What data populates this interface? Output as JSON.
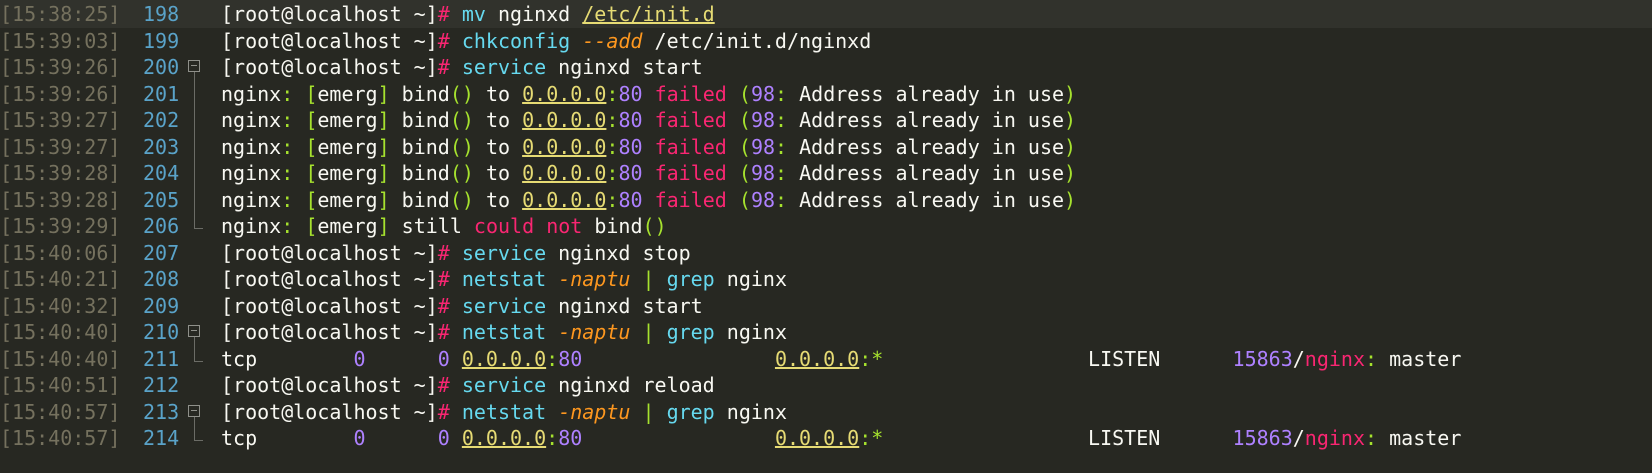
{
  "terminal": {
    "lines": [
      {
        "timestamp": "[15:38:25]",
        "line_number": "198",
        "fold": "none",
        "highlight": true,
        "segments": [
          {
            "t": "[root@localhost ~]",
            "c": "def"
          },
          {
            "t": "# ",
            "c": "pk"
          },
          {
            "t": "mv",
            "c": "cmd"
          },
          {
            "t": " nginxd ",
            "c": "def"
          },
          {
            "t": "/etc/init.d",
            "c": "ip"
          }
        ]
      },
      {
        "timestamp": "[15:39:03]",
        "line_number": "199",
        "fold": "none",
        "segments": [
          {
            "t": "[root@localhost ~]",
            "c": "def"
          },
          {
            "t": "# ",
            "c": "pk"
          },
          {
            "t": "chkconfig",
            "c": "cmd"
          },
          {
            "t": " ",
            "c": "def"
          },
          {
            "t": "--add",
            "c": "opt"
          },
          {
            "t": " /etc/init.d/nginxd",
            "c": "def"
          }
        ]
      },
      {
        "timestamp": "[15:39:26]",
        "line_number": "200",
        "fold": "open",
        "segments": [
          {
            "t": "[root@localhost ~]",
            "c": "def"
          },
          {
            "t": "# ",
            "c": "pk"
          },
          {
            "t": "service",
            "c": "cmd"
          },
          {
            "t": " nginxd start",
            "c": "def"
          }
        ]
      },
      {
        "timestamp": "[15:39:26]",
        "line_number": "201",
        "fold": "line",
        "segments": [
          {
            "t": "nginx",
            "c": "def"
          },
          {
            "t": ": ",
            "c": "br"
          },
          {
            "t": "[",
            "c": "br"
          },
          {
            "t": "emerg",
            "c": "def"
          },
          {
            "t": "]",
            "c": "br"
          },
          {
            "t": " bind",
            "c": "def"
          },
          {
            "t": "()",
            "c": "br"
          },
          {
            "t": " to ",
            "c": "def"
          },
          {
            "t": "0.0.0.0",
            "c": "ip"
          },
          {
            "t": ":",
            "c": "br"
          },
          {
            "t": "80",
            "c": "num"
          },
          {
            "t": " failed",
            "c": "fail"
          },
          {
            "t": " (",
            "c": "br"
          },
          {
            "t": "98",
            "c": "num"
          },
          {
            "t": ":",
            "c": "br"
          },
          {
            "t": " Address already in use",
            "c": "def"
          },
          {
            "t": ")",
            "c": "br"
          }
        ]
      },
      {
        "timestamp": "[15:39:27]",
        "line_number": "202",
        "fold": "line",
        "segments": [
          {
            "t": "nginx",
            "c": "def"
          },
          {
            "t": ": ",
            "c": "br"
          },
          {
            "t": "[",
            "c": "br"
          },
          {
            "t": "emerg",
            "c": "def"
          },
          {
            "t": "]",
            "c": "br"
          },
          {
            "t": " bind",
            "c": "def"
          },
          {
            "t": "()",
            "c": "br"
          },
          {
            "t": " to ",
            "c": "def"
          },
          {
            "t": "0.0.0.0",
            "c": "ip"
          },
          {
            "t": ":",
            "c": "br"
          },
          {
            "t": "80",
            "c": "num"
          },
          {
            "t": " failed",
            "c": "fail"
          },
          {
            "t": " (",
            "c": "br"
          },
          {
            "t": "98",
            "c": "num"
          },
          {
            "t": ":",
            "c": "br"
          },
          {
            "t": " Address already in use",
            "c": "def"
          },
          {
            "t": ")",
            "c": "br"
          }
        ]
      },
      {
        "timestamp": "[15:39:27]",
        "line_number": "203",
        "fold": "line",
        "segments": [
          {
            "t": "nginx",
            "c": "def"
          },
          {
            "t": ": ",
            "c": "br"
          },
          {
            "t": "[",
            "c": "br"
          },
          {
            "t": "emerg",
            "c": "def"
          },
          {
            "t": "]",
            "c": "br"
          },
          {
            "t": " bind",
            "c": "def"
          },
          {
            "t": "()",
            "c": "br"
          },
          {
            "t": " to ",
            "c": "def"
          },
          {
            "t": "0.0.0.0",
            "c": "ip"
          },
          {
            "t": ":",
            "c": "br"
          },
          {
            "t": "80",
            "c": "num"
          },
          {
            "t": " failed",
            "c": "fail"
          },
          {
            "t": " (",
            "c": "br"
          },
          {
            "t": "98",
            "c": "num"
          },
          {
            "t": ":",
            "c": "br"
          },
          {
            "t": " Address already in use",
            "c": "def"
          },
          {
            "t": ")",
            "c": "br"
          }
        ]
      },
      {
        "timestamp": "[15:39:28]",
        "line_number": "204",
        "fold": "line",
        "segments": [
          {
            "t": "nginx",
            "c": "def"
          },
          {
            "t": ": ",
            "c": "br"
          },
          {
            "t": "[",
            "c": "br"
          },
          {
            "t": "emerg",
            "c": "def"
          },
          {
            "t": "]",
            "c": "br"
          },
          {
            "t": " bind",
            "c": "def"
          },
          {
            "t": "()",
            "c": "br"
          },
          {
            "t": " to ",
            "c": "def"
          },
          {
            "t": "0.0.0.0",
            "c": "ip"
          },
          {
            "t": ":",
            "c": "br"
          },
          {
            "t": "80",
            "c": "num"
          },
          {
            "t": " failed",
            "c": "fail"
          },
          {
            "t": " (",
            "c": "br"
          },
          {
            "t": "98",
            "c": "num"
          },
          {
            "t": ":",
            "c": "br"
          },
          {
            "t": " Address already in use",
            "c": "def"
          },
          {
            "t": ")",
            "c": "br"
          }
        ]
      },
      {
        "timestamp": "[15:39:28]",
        "line_number": "205",
        "fold": "line",
        "segments": [
          {
            "t": "nginx",
            "c": "def"
          },
          {
            "t": ": ",
            "c": "br"
          },
          {
            "t": "[",
            "c": "br"
          },
          {
            "t": "emerg",
            "c": "def"
          },
          {
            "t": "]",
            "c": "br"
          },
          {
            "t": " bind",
            "c": "def"
          },
          {
            "t": "()",
            "c": "br"
          },
          {
            "t": " to ",
            "c": "def"
          },
          {
            "t": "0.0.0.0",
            "c": "ip"
          },
          {
            "t": ":",
            "c": "br"
          },
          {
            "t": "80",
            "c": "num"
          },
          {
            "t": " failed",
            "c": "fail"
          },
          {
            "t": " (",
            "c": "br"
          },
          {
            "t": "98",
            "c": "num"
          },
          {
            "t": ":",
            "c": "br"
          },
          {
            "t": " Address already in use",
            "c": "def"
          },
          {
            "t": ")",
            "c": "br"
          }
        ]
      },
      {
        "timestamp": "[15:39:29]",
        "line_number": "206",
        "fold": "end",
        "segments": [
          {
            "t": "nginx",
            "c": "def"
          },
          {
            "t": ": ",
            "c": "br"
          },
          {
            "t": "[",
            "c": "br"
          },
          {
            "t": "emerg",
            "c": "def"
          },
          {
            "t": "]",
            "c": "br"
          },
          {
            "t": " still ",
            "c": "def"
          },
          {
            "t": "could",
            "c": "fail"
          },
          {
            "t": " ",
            "c": "def"
          },
          {
            "t": "not",
            "c": "fail"
          },
          {
            "t": " bind",
            "c": "def"
          },
          {
            "t": "()",
            "c": "br"
          }
        ]
      },
      {
        "timestamp": "[15:40:06]",
        "line_number": "207",
        "fold": "none",
        "segments": [
          {
            "t": "[root@localhost ~]",
            "c": "def"
          },
          {
            "t": "# ",
            "c": "pk"
          },
          {
            "t": "service",
            "c": "cmd"
          },
          {
            "t": " nginxd stop",
            "c": "def"
          }
        ]
      },
      {
        "timestamp": "[15:40:21]",
        "line_number": "208",
        "fold": "none",
        "segments": [
          {
            "t": "[root@localhost ~]",
            "c": "def"
          },
          {
            "t": "# ",
            "c": "pk"
          },
          {
            "t": "netstat",
            "c": "cmd"
          },
          {
            "t": " ",
            "c": "def"
          },
          {
            "t": "-naptu",
            "c": "opt"
          },
          {
            "t": " | ",
            "c": "br"
          },
          {
            "t": "grep",
            "c": "cmd"
          },
          {
            "t": " nginx",
            "c": "def"
          }
        ]
      },
      {
        "timestamp": "[15:40:32]",
        "line_number": "209",
        "fold": "none",
        "segments": [
          {
            "t": "[root@localhost ~]",
            "c": "def"
          },
          {
            "t": "# ",
            "c": "pk"
          },
          {
            "t": "service",
            "c": "cmd"
          },
          {
            "t": " nginxd start",
            "c": "def"
          }
        ]
      },
      {
        "timestamp": "[15:40:40]",
        "line_number": "210",
        "fold": "open",
        "segments": [
          {
            "t": "[root@localhost ~]",
            "c": "def"
          },
          {
            "t": "# ",
            "c": "pk"
          },
          {
            "t": "netstat",
            "c": "cmd"
          },
          {
            "t": " ",
            "c": "def"
          },
          {
            "t": "-naptu",
            "c": "opt"
          },
          {
            "t": " | ",
            "c": "br"
          },
          {
            "t": "grep",
            "c": "cmd"
          },
          {
            "t": " nginx",
            "c": "def"
          }
        ]
      },
      {
        "timestamp": "[15:40:40]",
        "line_number": "211",
        "fold": "end",
        "segments": [
          {
            "t": "tcp        ",
            "c": "def"
          },
          {
            "t": "0",
            "c": "num"
          },
          {
            "t": "      ",
            "c": "def"
          },
          {
            "t": "0",
            "c": "num"
          },
          {
            "t": " ",
            "c": "def"
          },
          {
            "t": "0.0.0.0",
            "c": "ip"
          },
          {
            "t": ":",
            "c": "br"
          },
          {
            "t": "80",
            "c": "num"
          },
          {
            "t": "                ",
            "c": "def"
          },
          {
            "t": "0.0.0.0",
            "c": "ip"
          },
          {
            "t": ":",
            "c": "br"
          },
          {
            "t": "*",
            "c": "glob"
          },
          {
            "t": "                 LISTEN      ",
            "c": "def"
          },
          {
            "t": "15863",
            "c": "num"
          },
          {
            "t": "/",
            "c": "def"
          },
          {
            "t": "nginx",
            "c": "proc"
          },
          {
            "t": ": ",
            "c": "br"
          },
          {
            "t": "master",
            "c": "def"
          }
        ]
      },
      {
        "timestamp": "[15:40:51]",
        "line_number": "212",
        "fold": "none",
        "segments": [
          {
            "t": "[root@localhost ~]",
            "c": "def"
          },
          {
            "t": "# ",
            "c": "pk"
          },
          {
            "t": "service",
            "c": "cmd"
          },
          {
            "t": " nginxd reload",
            "c": "def"
          }
        ]
      },
      {
        "timestamp": "[15:40:57]",
        "line_number": "213",
        "fold": "open",
        "segments": [
          {
            "t": "[root@localhost ~]",
            "c": "def"
          },
          {
            "t": "# ",
            "c": "pk"
          },
          {
            "t": "netstat",
            "c": "cmd"
          },
          {
            "t": " ",
            "c": "def"
          },
          {
            "t": "-naptu",
            "c": "opt"
          },
          {
            "t": " | ",
            "c": "br"
          },
          {
            "t": "grep",
            "c": "cmd"
          },
          {
            "t": " nginx",
            "c": "def"
          }
        ]
      },
      {
        "timestamp": "[15:40:57]",
        "line_number": "214",
        "fold": "end",
        "segments": [
          {
            "t": "tcp        ",
            "c": "def"
          },
          {
            "t": "0",
            "c": "num"
          },
          {
            "t": "      ",
            "c": "def"
          },
          {
            "t": "0",
            "c": "num"
          },
          {
            "t": " ",
            "c": "def"
          },
          {
            "t": "0.0.0.0",
            "c": "ip"
          },
          {
            "t": ":",
            "c": "br"
          },
          {
            "t": "80",
            "c": "num"
          },
          {
            "t": "                ",
            "c": "def"
          },
          {
            "t": "0.0.0.0",
            "c": "ip"
          },
          {
            "t": ":",
            "c": "br"
          },
          {
            "t": "*",
            "c": "glob"
          },
          {
            "t": "                 LISTEN      ",
            "c": "def"
          },
          {
            "t": "15863",
            "c": "num"
          },
          {
            "t": "/",
            "c": "def"
          },
          {
            "t": "nginx",
            "c": "proc"
          },
          {
            "t": ": ",
            "c": "br"
          },
          {
            "t": "master",
            "c": "def"
          }
        ]
      }
    ]
  }
}
